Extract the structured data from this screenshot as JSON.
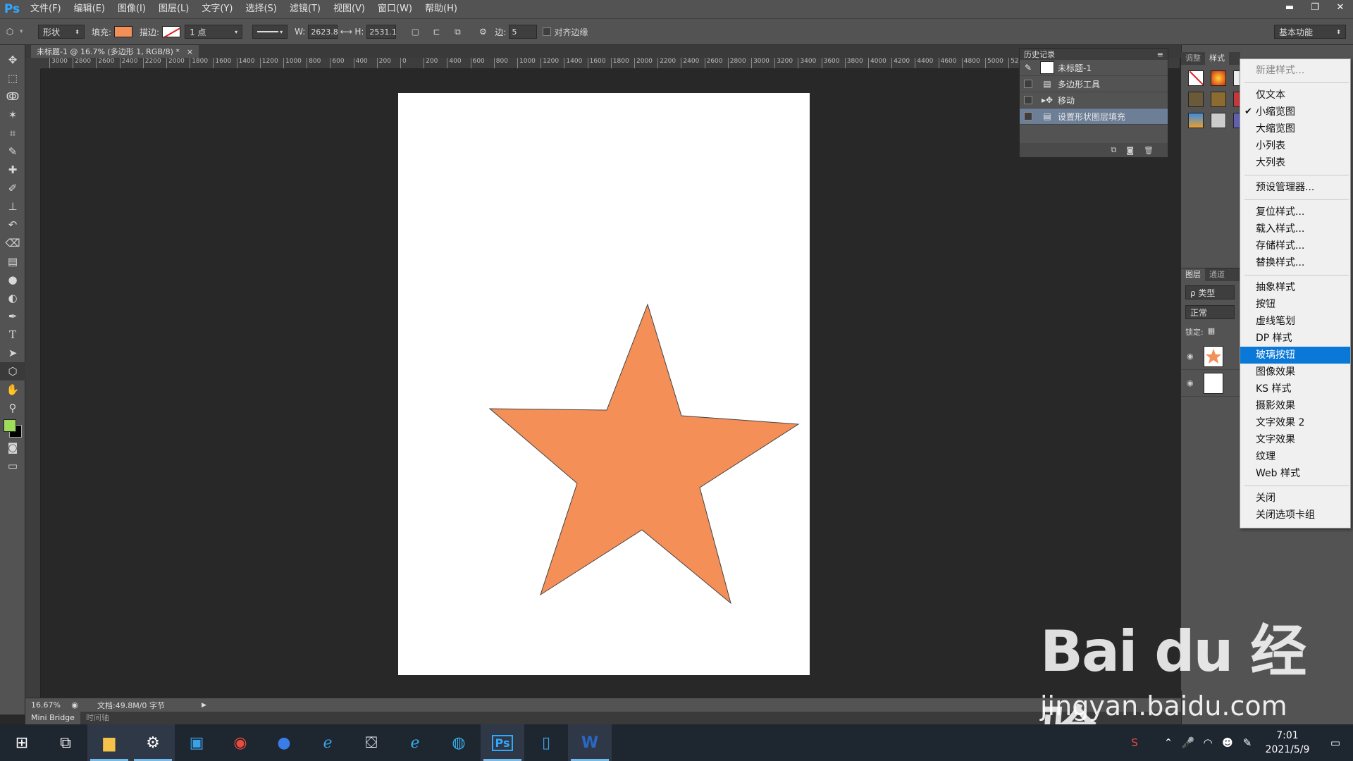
{
  "app": {
    "logo": "Ps"
  },
  "menu": [
    "文件(F)",
    "编辑(E)",
    "图像(I)",
    "图层(L)",
    "文字(Y)",
    "选择(S)",
    "滤镜(T)",
    "视图(V)",
    "窗口(W)",
    "帮助(H)"
  ],
  "options": {
    "mode": "形状",
    "fill_label": "填充:",
    "stroke_label": "描边:",
    "stroke_size": "1 点",
    "w_label": "W:",
    "w_value": "2623.8",
    "h_label": "H:",
    "h_value": "2531.1",
    "sides_label": "边:",
    "sides_value": "5",
    "align_edges": "对齐边缘",
    "workspace": "基本功能",
    "fill_color": "#f48f57"
  },
  "document": {
    "tab_title": "未标题-1 @ 16.7% (多边形 1, RGB/8) *",
    "close": "×",
    "zoom": "16.67%",
    "doc_info": "文档:49.8M/0 字节"
  },
  "ruler_h": [
    "3000",
    "2800",
    "2600",
    "2400",
    "2200",
    "2000",
    "1800",
    "1600",
    "1400",
    "1200",
    "1000",
    "800",
    "600",
    "400",
    "200",
    "0",
    "200",
    "400",
    "600",
    "800",
    "1000",
    "1200",
    "1400",
    "1600",
    "1800",
    "2000",
    "2200",
    "2400",
    "2600",
    "2800",
    "3000",
    "3200",
    "3400",
    "3600",
    "3800",
    "4000",
    "4200",
    "4400",
    "4600",
    "4800",
    "5000",
    "52"
  ],
  "bottom_tabs": {
    "mini_bridge": "Mini Bridge",
    "timeline": "时间轴"
  },
  "history": {
    "title": "历史记录",
    "snapshot": "未标题-1",
    "items": [
      "多边形工具",
      "移动",
      "设置形状图层填充"
    ]
  },
  "styles_panel": {
    "tabs": [
      "调整",
      "样式"
    ]
  },
  "layers_panel": {
    "tabs": [
      "图层",
      "通道"
    ],
    "filter": "ρ 类型",
    "blend": "正常",
    "lock_label": "锁定:"
  },
  "flyout": {
    "new_style": "新建样式...",
    "view_items": [
      "仅文本",
      "小缩览图",
      "大缩览图",
      "小列表",
      "大列表"
    ],
    "checked": "小缩览图",
    "preset_manager": "预设管理器...",
    "style_ops": [
      "复位样式...",
      "载入样式...",
      "存储样式...",
      "替换样式..."
    ],
    "libraries": [
      "抽象样式",
      "按钮",
      "虚线笔划",
      "DP 样式",
      "玻璃按钮",
      "图像效果",
      "KS 样式",
      "摄影效果",
      "文字效果 2",
      "文字效果",
      "纹理",
      "Web 样式"
    ],
    "highlighted": "玻璃按钮",
    "close_items": [
      "关闭",
      "关闭选项卡组"
    ]
  },
  "watermark": {
    "brand": "Bai du 经验",
    "url": "jingyan.baidu.com"
  },
  "taskbar": {
    "time": "7:01",
    "date": "2021/5/9"
  }
}
